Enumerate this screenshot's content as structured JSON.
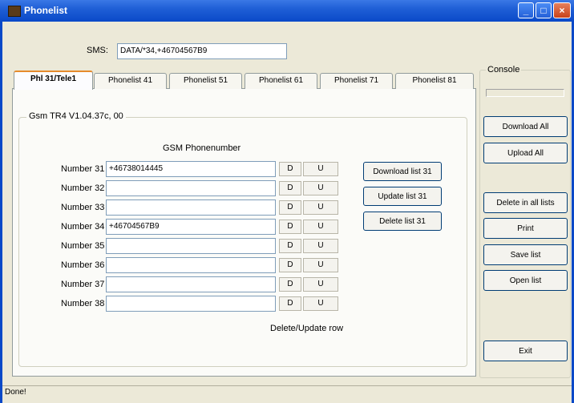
{
  "window": {
    "title": "Phonelist"
  },
  "sms": {
    "label": "SMS:",
    "value": "DATA/*34,+46704567B9"
  },
  "tabs": [
    {
      "label": "Phl 31/Tele1"
    },
    {
      "label": "Phonelist 41"
    },
    {
      "label": "Phonelist 51"
    },
    {
      "label": "Phonelist 61"
    },
    {
      "label": "Phonelist 71"
    },
    {
      "label": "Phonelist 81"
    }
  ],
  "panel": {
    "group_label": "Gsm TR4 V1.04.37c, 00",
    "header": "GSM Phonenumber",
    "rows": [
      {
        "label": "Number 31",
        "value": "+46738014445",
        "d": "D",
        "u": "U"
      },
      {
        "label": "Number 32",
        "value": "",
        "d": "D",
        "u": "U"
      },
      {
        "label": "Number 33",
        "value": "",
        "d": "D",
        "u": "U"
      },
      {
        "label": "Number 34",
        "value": "+46704567B9",
        "d": "D",
        "u": "U"
      },
      {
        "label": "Number 35",
        "value": "",
        "d": "D",
        "u": "U"
      },
      {
        "label": "Number 36",
        "value": "",
        "d": "D",
        "u": "U"
      },
      {
        "label": "Number 37",
        "value": "",
        "d": "D",
        "u": "U"
      },
      {
        "label": "Number 38",
        "value": "",
        "d": "D",
        "u": "U"
      }
    ],
    "row_hint": "Delete/Update row",
    "download_list": "Download list 31",
    "update_list": "Update list 31",
    "delete_list": "Delete list 31"
  },
  "console": {
    "label": "Console",
    "download_all": "Download All",
    "upload_all": "Upload All",
    "delete_all": "Delete in all lists",
    "print": "Print",
    "save_list": "Save list",
    "open_list": "Open list",
    "exit": "Exit"
  },
  "status": {
    "text": "Done!"
  }
}
